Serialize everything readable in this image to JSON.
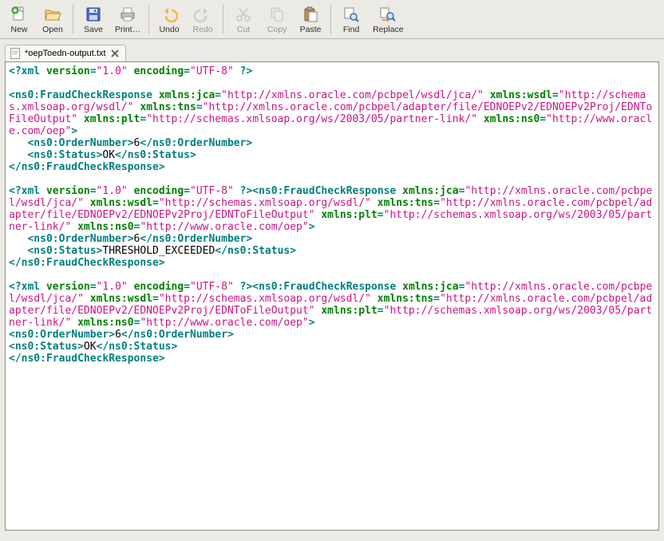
{
  "toolbar": {
    "new": "New",
    "open": "Open",
    "save": "Save",
    "print": "Print…",
    "undo": "Undo",
    "redo": "Redo",
    "cut": "Cut",
    "copy": "Copy",
    "paste": "Paste",
    "find": "Find",
    "replace": "Replace"
  },
  "tab": {
    "title": "*oepToedn-output.txt"
  },
  "editor": {
    "blocks": [
      {
        "decl": {
          "pre": "<?xml ",
          "attrs": [
            {
              "k": "version",
              "v": "\"1.0\""
            },
            {
              "k": "encoding",
              "v": "\"UTF-8\""
            }
          ],
          "post": " ?>"
        },
        "inline_root_after_decl": false,
        "root_open": {
          "name": "<ns0:FraudCheckResponse ",
          "attrs": [
            {
              "k": "xmlns:jca",
              "v": "\"http://xmlns.oracle.com/pcbpel/wsdl/jca/\""
            },
            {
              "k": "xmlns:wsdl",
              "v": "\"http://schemas.xmlsoap.org/wsdl/\""
            },
            {
              "k": "xmlns:tns",
              "v": "\"http://xmlns.oracle.com/pcbpel/adapter/file/EDNOEPv2/EDNOEPv2Proj/EDNToFileOutput\""
            },
            {
              "k": "xmlns:plt",
              "v": "\"http://schemas.xmlsoap.org/ws/2003/05/partner-link/\""
            },
            {
              "k": "xmlns:ns0",
              "v": "\"http://www.oracle.com/oep\""
            }
          ]
        },
        "children": [
          {
            "indent": "   ",
            "open": "<ns0:OrderNumber>",
            "text": "6",
            "close": "</ns0:OrderNumber>"
          },
          {
            "indent": "   ",
            "open": "<ns0:Status>",
            "text": "OK",
            "close": "</ns0:Status>"
          }
        ],
        "root_close": "</ns0:FraudCheckResponse>",
        "child_indent": true
      },
      {
        "decl": {
          "pre": "<?xml ",
          "attrs": [
            {
              "k": "version",
              "v": "\"1.0\""
            },
            {
              "k": "encoding",
              "v": "\"UTF-8\""
            }
          ],
          "post": " ?>"
        },
        "inline_root_after_decl": true,
        "root_open": {
          "name": "<ns0:FraudCheckResponse ",
          "attrs": [
            {
              "k": "xmlns:jca",
              "v": "\"http://xmlns.oracle.com/pcbpel/wsdl/jca/\""
            },
            {
              "k": "xmlns:wsdl",
              "v": "\"http://schemas.xmlsoap.org/wsdl/\""
            },
            {
              "k": "xmlns:tns",
              "v": "\"http://xmlns.oracle.com/pcbpel/adapter/file/EDNOEPv2/EDNOEPv2Proj/EDNToFileOutput\""
            },
            {
              "k": "xmlns:plt",
              "v": "\"http://schemas.xmlsoap.org/ws/2003/05/partner-link/\""
            },
            {
              "k": "xmlns:ns0",
              "v": "\"http://www.oracle.com/oep\""
            }
          ]
        },
        "children": [
          {
            "indent": "   ",
            "open": "<ns0:OrderNumber>",
            "text": "6",
            "close": "</ns0:OrderNumber>"
          },
          {
            "indent": "   ",
            "open": "<ns0:Status>",
            "text": "THRESHOLD_EXCEEDED",
            "close": "</ns0:Status>"
          }
        ],
        "root_close": "</ns0:FraudCheckResponse>",
        "child_indent": true
      },
      {
        "decl": {
          "pre": "<?xml ",
          "attrs": [
            {
              "k": "version",
              "v": "\"1.0\""
            },
            {
              "k": "encoding",
              "v": "\"UTF-8\""
            }
          ],
          "post": " ?>"
        },
        "inline_root_after_decl": true,
        "root_open": {
          "name": "<ns0:FraudCheckResponse ",
          "attrs": [
            {
              "k": "xmlns:jca",
              "v": "\"http://xmlns.oracle.com/pcbpel/wsdl/jca/\""
            },
            {
              "k": "xmlns:wsdl",
              "v": "\"http://schemas.xmlsoap.org/wsdl/\""
            },
            {
              "k": "xmlns:tns",
              "v": "\"http://xmlns.oracle.com/pcbpel/adapter/file/EDNOEPv2/EDNOEPv2Proj/EDNToFileOutput\""
            },
            {
              "k": "xmlns:plt",
              "v": "\"http://schemas.xmlsoap.org/ws/2003/05/partner-link/\""
            },
            {
              "k": "xmlns:ns0",
              "v": "\"http://www.oracle.com/oep\""
            }
          ]
        },
        "children": [
          {
            "indent": "",
            "open": "<ns0:OrderNumber>",
            "text": "6",
            "close": "</ns0:OrderNumber>"
          },
          {
            "indent": "",
            "open": "<ns0:Status>",
            "text": "OK",
            "close": "</ns0:Status>"
          }
        ],
        "root_close": "</ns0:FraudCheckResponse>",
        "child_indent": false
      }
    ]
  }
}
